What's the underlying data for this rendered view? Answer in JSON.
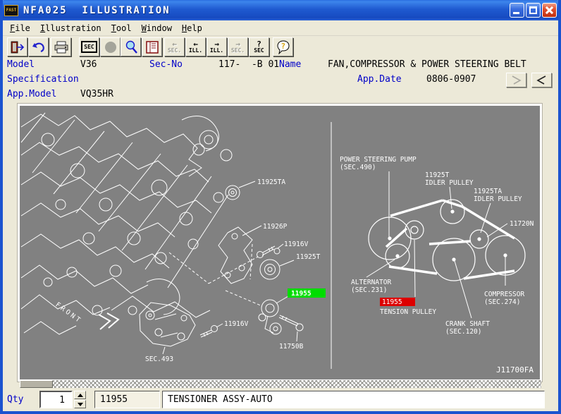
{
  "window": {
    "logo": "FAST",
    "title": "NFA025  ILLUSTRATION"
  },
  "menu": {
    "items": [
      {
        "label": "File"
      },
      {
        "label": "Illustration"
      },
      {
        "label": "Tool"
      },
      {
        "label": "Window"
      },
      {
        "label": "Help"
      }
    ]
  },
  "toolbar": {
    "sec_box_label": "SEC",
    "nav_prev_sec": {
      "arrow": "←",
      "label": "SEC."
    },
    "nav_prev_ill": {
      "arrow": "←",
      "label": "ILL."
    },
    "nav_next_ill": {
      "arrow": "→",
      "label": "ILL."
    },
    "nav_next_sec": {
      "arrow": "→",
      "label": "SEC."
    },
    "sec_q": {
      "arrow": "?",
      "label": "SEC"
    },
    "help_q": "?"
  },
  "info": {
    "model_label": "Model",
    "model": "V36",
    "secno_label": "Sec-No",
    "secno": "117-  -B 01",
    "name_label": "Name",
    "name": "FAN,COMPRESSOR & POWER STEERING BELT",
    "spec_label": "Specification",
    "appdate_label": "App.Date",
    "appdate": "0806-0907",
    "appmodel_label": "App.Model",
    "appmodel": "VQ35HR"
  },
  "illustration": {
    "figure_id": "J11700FA",
    "front_label": "FRONT",
    "left": {
      "idler_ta": "11925TA",
      "bracket": "11926P",
      "bolt_a": "11916V",
      "idler_t": "11925T",
      "tensioner_part": "11955",
      "bolt_b": "11916V",
      "sec_ref": "SEC.493",
      "bolt_c": "11750B"
    },
    "right": {
      "ps_pump_1": "POWER STEERING PUMP",
      "ps_pump_2": "(SEC.490)",
      "idler_t_1": "11925T",
      "idler_t_2": "IDLER PULLEY",
      "idler_ta_1": "11925TA",
      "idler_ta_2": "IDLER PULLEY",
      "belt": "11720N",
      "alternator_1": "ALTERNATOR",
      "alternator_2": "(SEC.231)",
      "tension_part": "11955",
      "tension_name": "TENSION PULLEY",
      "compressor_1": "COMPRESSOR",
      "compressor_2": "(SEC.274)",
      "crank_1": "CRANK SHAFT",
      "crank_2": "(SEC.120)"
    },
    "colors": {
      "highlight_green": "#00dd00",
      "highlight_red": "#dd0000",
      "background": "#818181",
      "line": "#ffffff"
    }
  },
  "bottom": {
    "qty_label": "Qty",
    "qty_value": "1",
    "part_no": "11955",
    "part_name": "TENSIONER ASSY-AUTO"
  }
}
